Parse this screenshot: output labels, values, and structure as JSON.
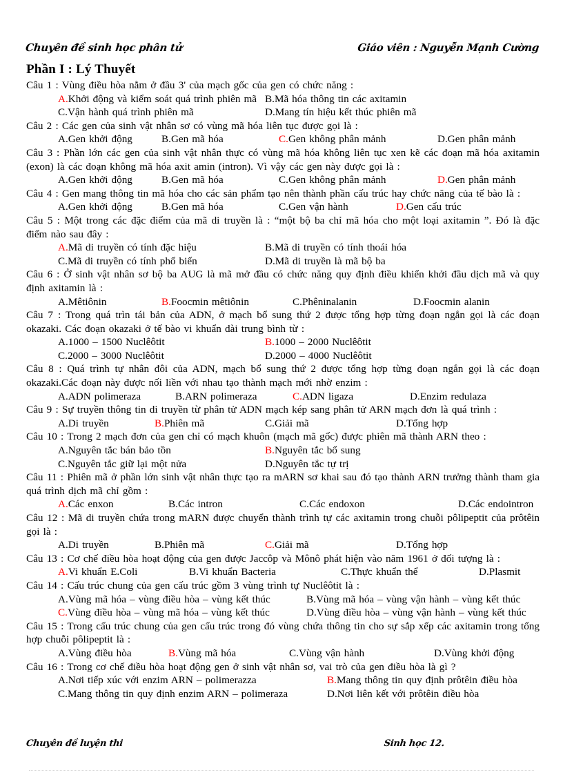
{
  "header": {
    "left": "Chuyên đề sinh học phân tử",
    "right": "Giáo viên : Nguyễn Mạnh Cường"
  },
  "footer": {
    "left": "Chuyên đề luyện thi",
    "right": "Sinh học 12."
  },
  "section": {
    "title": "Phần I : Lý Thuyết"
  },
  "questions": [
    {
      "label": "Câu 1 :",
      "stem": "Vùng điều hòa nằm ở đầu 3' của mạch gốc của gen có chức năng :",
      "answer": "A",
      "options": [
        {
          "mark": "A.",
          "text": "Khởi động và kiểm soát quá trình phiên mã"
        },
        {
          "mark": "B.",
          "text": "Mã hóa thông tin các axitamin"
        },
        {
          "mark": "C.",
          "text": "Vận hành quá trình phiên mã"
        },
        {
          "mark": "D.",
          "text": "Mang tín hiệu kết thúc phiên mã"
        }
      ]
    },
    {
      "label": "Câu 2 :",
      "stem": "Các gen của sinh vật nhân sơ có vùng mã hóa liên tục được gọi là :",
      "answer": "C",
      "options": [
        {
          "mark": "A.",
          "text": "Gen khởi động"
        },
        {
          "mark": "B.",
          "text": "Gen mã hóa"
        },
        {
          "mark": "C.",
          "text": "Gen không phân mảnh"
        },
        {
          "mark": "D.",
          "text": "Gen phân mảnh"
        }
      ]
    },
    {
      "label": "Câu 3 :",
      "stem": "Phần lớn các gen của sinh vật nhân thực có vùng mã hóa không liên tục xen kẽ các đoạn mã hóa axitamin (exon) là các đoạn không mã hóa axit amin (intron). Vì vậy các gen này được gọi là :",
      "answer": "D",
      "options": [
        {
          "mark": "A.",
          "text": "Gen khởi động"
        },
        {
          "mark": "B.",
          "text": "Gen mã hóa"
        },
        {
          "mark": "C.",
          "text": "Gen không phân mảnh"
        },
        {
          "mark": "D.",
          "text": "Gen phân mảnh"
        }
      ]
    },
    {
      "label": "Câu 4 :",
      "stem": "Gen mang thông tin mã hóa cho các sản phẩm tạo nên thành phần cấu trúc hay chức năng của tế bào là :",
      "answer": "D",
      "options": [
        {
          "mark": "A.",
          "text": "Gen khởi động"
        },
        {
          "mark": "B.",
          "text": "Gen mã hóa"
        },
        {
          "mark": "C.",
          "text": "Gen vận hành"
        },
        {
          "mark": "D.",
          "text": "Gen cấu trúc"
        }
      ]
    },
    {
      "label": "Câu 5 :",
      "stem": "Một trong các đặc điểm của mã di truyền là : “một bộ ba chỉ mã hóa cho một loại axitamin ”. Đó là đặc điểm nào sau đây :",
      "answer": "A",
      "options": [
        {
          "mark": "A.",
          "text": "Mã di truyền có tính đặc hiệu"
        },
        {
          "mark": "B.",
          "text": "Mã di truyền có tính thoái hóa"
        },
        {
          "mark": "C.",
          "text": "Mã di truyền có tính phổ biến"
        },
        {
          "mark": "D.",
          "text": "Mã di truyền là mã bộ ba"
        }
      ]
    },
    {
      "label": "Câu 6 :",
      "stem": "Ở sinh vật nhân sơ bộ ba AUG là mã mở đầu có chức năng quy định điều khiển khởi đầu dịch mã và quy định axitamin là :",
      "answer": "B",
      "options": [
        {
          "mark": "A.",
          "text": "Mêtiônin"
        },
        {
          "mark": "B.",
          "text": "Foocmin mêtiônin"
        },
        {
          "mark": "C.",
          "text": "Phêninalanin"
        },
        {
          "mark": "D.",
          "text": "Foocmin alanin"
        }
      ]
    },
    {
      "label": "Câu 7 :",
      "stem": "Trong quá trìn tái bản của ADN, ở mạch bổ sung thứ 2 được tổng hợp từng đoạn ngắn gọi là các đoạn okazaki. Các đoạn okazaki ở tế bào vi khuẩn dài trung bình từ :",
      "answer": "B",
      "options": [
        {
          "mark": "A.",
          "text": "1000 – 1500 Nuclêôtit"
        },
        {
          "mark": "B.",
          "text": "1000 – 2000 Nuclêôtit"
        },
        {
          "mark": "C.",
          "text": "2000 – 3000 Nuclêôtit"
        },
        {
          "mark": "D.",
          "text": "2000 – 4000 Nuclêôtit"
        }
      ]
    },
    {
      "label": "Câu 8 :",
      "stem": "Quá trình tự nhân đôi của ADN, mạch bổ sung thứ 2 được tổng hợp từng đoạn ngắn gọi là các đoạn okazaki.Các đoạn này được nối liền với nhau tạo thành mạch mới nhờ enzim :",
      "answer": "C",
      "options": [
        {
          "mark": "A.",
          "text": "ADN polimeraza"
        },
        {
          "mark": "B.",
          "text": "ARN polimeraza"
        },
        {
          "mark": "C.",
          "text": "ADN ligaza"
        },
        {
          "mark": "D.",
          "text": "Enzim redulaza"
        }
      ]
    },
    {
      "label": "Câu 9 :",
      "stem": "Sự truyền thông tin di truyền từ phân tử ADN mạch kép sang phân tử ARN mạch đơn là quá trình :",
      "answer": "B",
      "options": [
        {
          "mark": "A.",
          "text": "Di truyền"
        },
        {
          "mark": "B.",
          "text": "Phiên mã"
        },
        {
          "mark": "C.",
          "text": "Giải mã"
        },
        {
          "mark": "D.",
          "text": "Tổng hợp"
        }
      ]
    },
    {
      "label": "Câu 10 :",
      "stem": "Trong 2 mạch đơn của gen chỉ có mạch khuôn (mạch mã gốc) được phiên mã thành ARN theo :",
      "answer": "B",
      "options": [
        {
          "mark": "A.",
          "text": "Nguyên tắc bán bảo tồn"
        },
        {
          "mark": "B.",
          "text": "Nguyên tắc bổ sung"
        },
        {
          "mark": "C.",
          "text": "Nguyên tắc giữ lại một nửa"
        },
        {
          "mark": "D.",
          "text": "Nguyên tắc tự trị"
        }
      ]
    },
    {
      "label": "Câu 11 :",
      "stem": "Phiên mã ở phần lớn sinh vật nhân thực tạo ra mARN sơ khai sau đó tạo thành ARN trưởng thành tham gia quá trình dịch mã chỉ gồm :",
      "answer": "A",
      "options": [
        {
          "mark": "A.",
          "text": "Các enxon"
        },
        {
          "mark": "B.",
          "text": "Các intron"
        },
        {
          "mark": "C.",
          "text": "Các endoxon"
        },
        {
          "mark": "D.",
          "text": "Các endointron"
        }
      ]
    },
    {
      "label": "Câu 12 :",
      "stem": "Mã di truyền chứa trong mARN được chuyển thành trình tự các axitamin trong chuỗi pôlipeptit của prôtêin gọi là :",
      "answer": "C",
      "options": [
        {
          "mark": "A.",
          "text": "Di truyền"
        },
        {
          "mark": "B.",
          "text": "Phiên mã"
        },
        {
          "mark": "C.",
          "text": "Giải mã"
        },
        {
          "mark": "D.",
          "text": "Tổng hợp"
        }
      ]
    },
    {
      "label": "Câu 13 :",
      "stem": "Cơ chế điều hòa hoạt động của gen được Jaccôp và Mônô phát hiện vào năm 1961 ở đối tượng là :",
      "answer": "A",
      "options": [
        {
          "mark": "A.",
          "text": "Vi khuẩn E.Coli"
        },
        {
          "mark": "B.",
          "text": "Vi khuẩn Bacteria"
        },
        {
          "mark": "C.",
          "text": "Thực khuẩn thể"
        },
        {
          "mark": "D.",
          "text": "Plasmit"
        }
      ]
    },
    {
      "label": "Câu 14 :",
      "stem": "Cấu trúc chung của gen cấu trúc gồm 3 vùng trình tự Nuclêôtit là :",
      "answer": "C",
      "options": [
        {
          "mark": "A.",
          "text": "Vùng mã hóa – vùng điều hòa – vùng kết thúc"
        },
        {
          "mark": "B.",
          "text": "Vùng mã hóa – vùng vận hành – vùng kết thúc"
        },
        {
          "mark": "C.",
          "text": "Vùng điều hòa – vùng mã hóa – vùng kết thúc"
        },
        {
          "mark": "D.",
          "text": "Vùng điều hòa – vùng vận hành – vùng kết thúc"
        }
      ]
    },
    {
      "label": "Câu 15 :",
      "stem": "Trong cấu trúc chung của gen cấu trúc trong đó vùng chứa thông tin cho sự sắp xếp các axitamin trong tổng hợp chuỗi pôlipeptit là :",
      "answer": "B",
      "options": [
        {
          "mark": "A.",
          "text": "Vùng điều hòa"
        },
        {
          "mark": "B.",
          "text": "Vùng mã hóa"
        },
        {
          "mark": "C.",
          "text": "Vùng vận hành"
        },
        {
          "mark": "D.",
          "text": "Vùng khởi động"
        }
      ]
    },
    {
      "label": "Câu 16 :",
      "stem": "Trong cơ chế điều hòa hoạt động gen ở sinh vật nhân sơ, vai trò của gen điều hòa là gì ?",
      "answer": "B",
      "options": [
        {
          "mark": "A.",
          "text": "Nơi tiếp xúc với enzim ARN – polimerazza"
        },
        {
          "mark": "B.",
          "text": "Mang thông tin quy định prôtêin điều hòa"
        },
        {
          "mark": "C.",
          "text": "Mang thông tin quy định enzim ARN – polimeraza"
        },
        {
          "mark": "D.",
          "text": "Nơi liên kết với prôtêin điều hòa"
        }
      ]
    }
  ],
  "colors": {
    "correct_answer": "#ff0000",
    "text": "#000000",
    "background": "#ffffff"
  },
  "layout": {
    "q1": [
      "w300",
      "w330"
    ],
    "q2": [
      "w150",
      "w170",
      "w230"
    ],
    "q3": [
      "w150",
      "w170",
      "w230"
    ],
    "q4": [
      "w150",
      "w170",
      "w170"
    ],
    "q5": [
      "w300",
      "w330"
    ],
    "q6": [
      "w150",
      "w190",
      "w175"
    ],
    "q7": [
      "w300",
      "w330"
    ],
    "q8": [
      "w170",
      "w170",
      "w170"
    ],
    "q9": [
      "w140",
      "w160",
      "w190"
    ],
    "q10": [
      "w300",
      "w330"
    ],
    "q11": [
      "w160",
      "w190",
      "w230"
    ],
    "q12": [
      "w140",
      "w160",
      "w190"
    ],
    "q13": [
      "w190",
      "w220",
      "w200"
    ],
    "q14": [
      "w360",
      "w390"
    ],
    "q15": [
      "w160",
      "w175",
      "w210"
    ],
    "q16": [
      "w390",
      "w390"
    ]
  }
}
